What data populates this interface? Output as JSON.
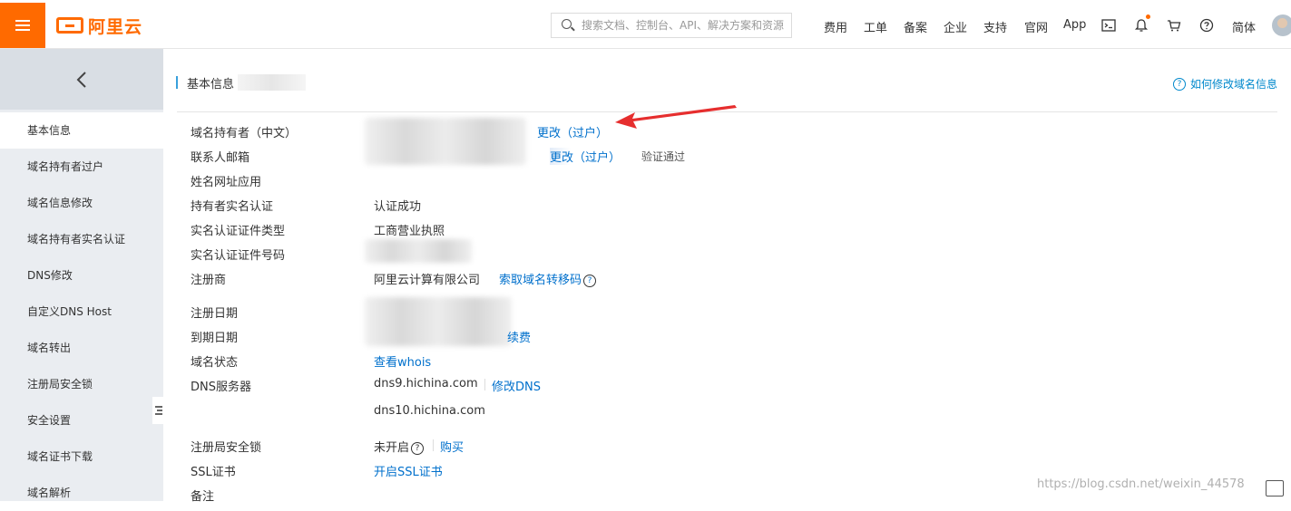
{
  "topbar": {
    "logo_text": "阿里云",
    "search_placeholder": "搜索文档、控制台、API、解决方案和资源",
    "nav": [
      "费用",
      "工单",
      "备案",
      "企业",
      "支持",
      "官网",
      "App"
    ],
    "lang": "简体",
    "accent_color": "#ff6a00"
  },
  "sidebar": {
    "items": [
      {
        "label": "基本信息",
        "active": true
      },
      {
        "label": "域名持有者过户"
      },
      {
        "label": "域名信息修改"
      },
      {
        "label": "域名持有者实名认证"
      },
      {
        "label": "DNS修改"
      },
      {
        "label": "自定义DNS Host"
      },
      {
        "label": "域名转出"
      },
      {
        "label": "注册局安全锁"
      },
      {
        "label": "安全设置"
      },
      {
        "label": "域名证书下载"
      },
      {
        "label": "域名解析"
      }
    ]
  },
  "main": {
    "title": "基本信息",
    "help_link": "如何修改域名信息",
    "rows": {
      "owner_label": "域名持有者（中文）",
      "owner_action": "更改（过户）",
      "email_label": "联系人邮箱",
      "email_action": "更改（过户）",
      "email_status": "验证通过",
      "name_url_label": "姓名网址应用",
      "realname_label": "持有者实名认证",
      "realname_value": "认证成功",
      "cert_type_label": "实名认证证件类型",
      "cert_type_value": "工商营业执照",
      "cert_no_label": "实名认证证件号码",
      "registrar_label": "注册商",
      "registrar_value": "阿里云计算有限公司",
      "registrar_action": "索取域名转移码",
      "reg_date_label": "注册日期",
      "exp_date_label": "到期日期",
      "exp_action": "续费",
      "status_label": "域名状态",
      "status_action": "查看whois",
      "dns_label": "DNS服务器",
      "dns1": "dns9.hichina.com",
      "dns_action": "修改DNS",
      "dns2": "dns10.hichina.com",
      "lock_label": "注册局安全锁",
      "lock_value": "未开启",
      "lock_action": "购买",
      "ssl_label": "SSL证书",
      "ssl_action": "开启SSL证书",
      "note_label": "备注"
    }
  },
  "watermark": "https://blog.csdn.net/weixin_44578"
}
